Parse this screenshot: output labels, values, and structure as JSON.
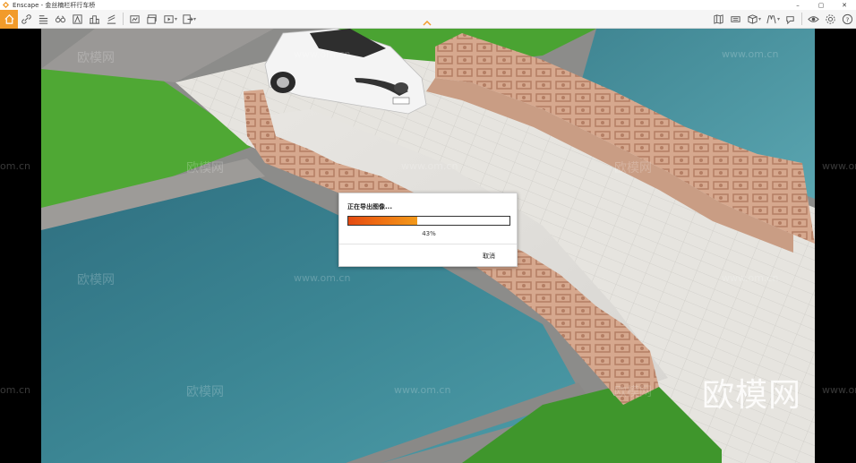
{
  "window": {
    "title": "Enscape - 金丝楠栏杆行车桥",
    "logo_icon": "enscape-logo-icon"
  },
  "window_controls": {
    "minimize": "–",
    "maximize": "▢",
    "close": "✕"
  },
  "toolbar": {
    "left_icons": [
      "home-icon",
      "link-icon",
      "settings-list-icon",
      "binoculars-icon",
      "assets-icon",
      "buildings-icon",
      "section-icon",
      "screenshot-icon",
      "batch-render-icon",
      "video-editor-icon",
      "export-icon"
    ],
    "right_icons": [
      "map-icon",
      "panorama-icon",
      "material-icon",
      "view-icon",
      "capture-icon",
      "visual-settings-icon",
      "preferences-icon",
      "help-icon"
    ],
    "accent_color": "#f29b2a"
  },
  "dialog": {
    "title": "正在导出图像...",
    "progress_fraction": 0.43,
    "progress_text": "43%",
    "cancel_label": "取消"
  },
  "watermark": {
    "brand": "欧模网",
    "url": "www.om.cn",
    "url_short": "om.cn"
  }
}
